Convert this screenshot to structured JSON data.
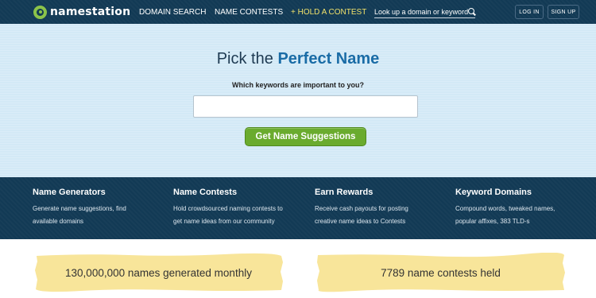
{
  "nav": {
    "logo_text": "namestation",
    "links": [
      "DOMAIN SEARCH",
      "NAME CONTESTS",
      "+ HOLD A CONTEST"
    ],
    "search_placeholder": "Look up a domain or keyword",
    "login": "LOG IN",
    "signup": "SIGN UP"
  },
  "hero": {
    "title_prefix": "Pick the",
    "title_emphasis": "Perfect Name",
    "question": "Which keywords are important to you?",
    "input_value": "",
    "button": "Get Name Suggestions"
  },
  "features": [
    {
      "title": "Name Generators",
      "line1": "Generate name suggestions, find",
      "line2": "available domains"
    },
    {
      "title": "Name Contests",
      "line1": "Hold crowdsourced naming contests to",
      "line2": "get name ideas from our community"
    },
    {
      "title": "Earn Rewards",
      "line1": "Receive cash payouts for posting",
      "line2": "creative name ideas to Contests"
    },
    {
      "title": "Keyword Domains",
      "line1": "Compound words, tweaked names,",
      "line2": "popular affixes, 383 TLD-s"
    }
  ],
  "stats": [
    "130,000,000 names generated monthly",
    "7789 name contests held"
  ],
  "colors": {
    "nav_bg": "#123a55",
    "hero_bg": "#d3e9f6",
    "accent_green": "#6aab2e",
    "title_blue": "#1a6ca6",
    "hold_contest": "#f0e06a",
    "highlight": "#f8e59a"
  }
}
